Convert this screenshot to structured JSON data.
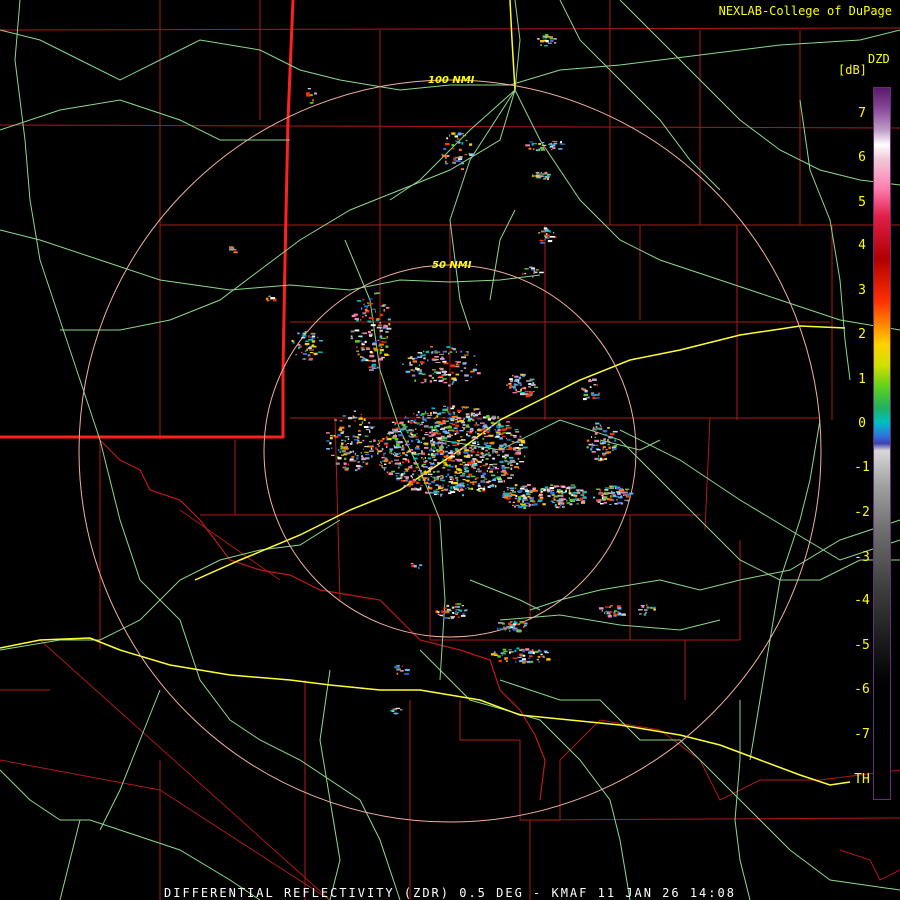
{
  "credit": "NEXLAB-College of DuPage",
  "scale": {
    "title": "DZD",
    "unit": "[dB]",
    "ticks": [
      "7",
      "6",
      "5",
      "4",
      "3",
      "2",
      "1",
      "0",
      "-1",
      "-2",
      "-3",
      "-4",
      "-5",
      "-6",
      "-7",
      "TH"
    ]
  },
  "rings": [
    {
      "label": "100 NMI"
    },
    {
      "label": "50 NMI"
    }
  ],
  "footer": "DIFFERENTIAL REFLECTIVITY (ZDR) 0.5 DEG - KMAF 11 JAN 26 14:08",
  "colors": {
    "county_lines": "#b01818",
    "state_line": "#ff2020",
    "highways": "#8cd88c",
    "interstate": "#ffff30",
    "range_rings": "#f0b0a0",
    "labels": "#ffff00"
  }
}
